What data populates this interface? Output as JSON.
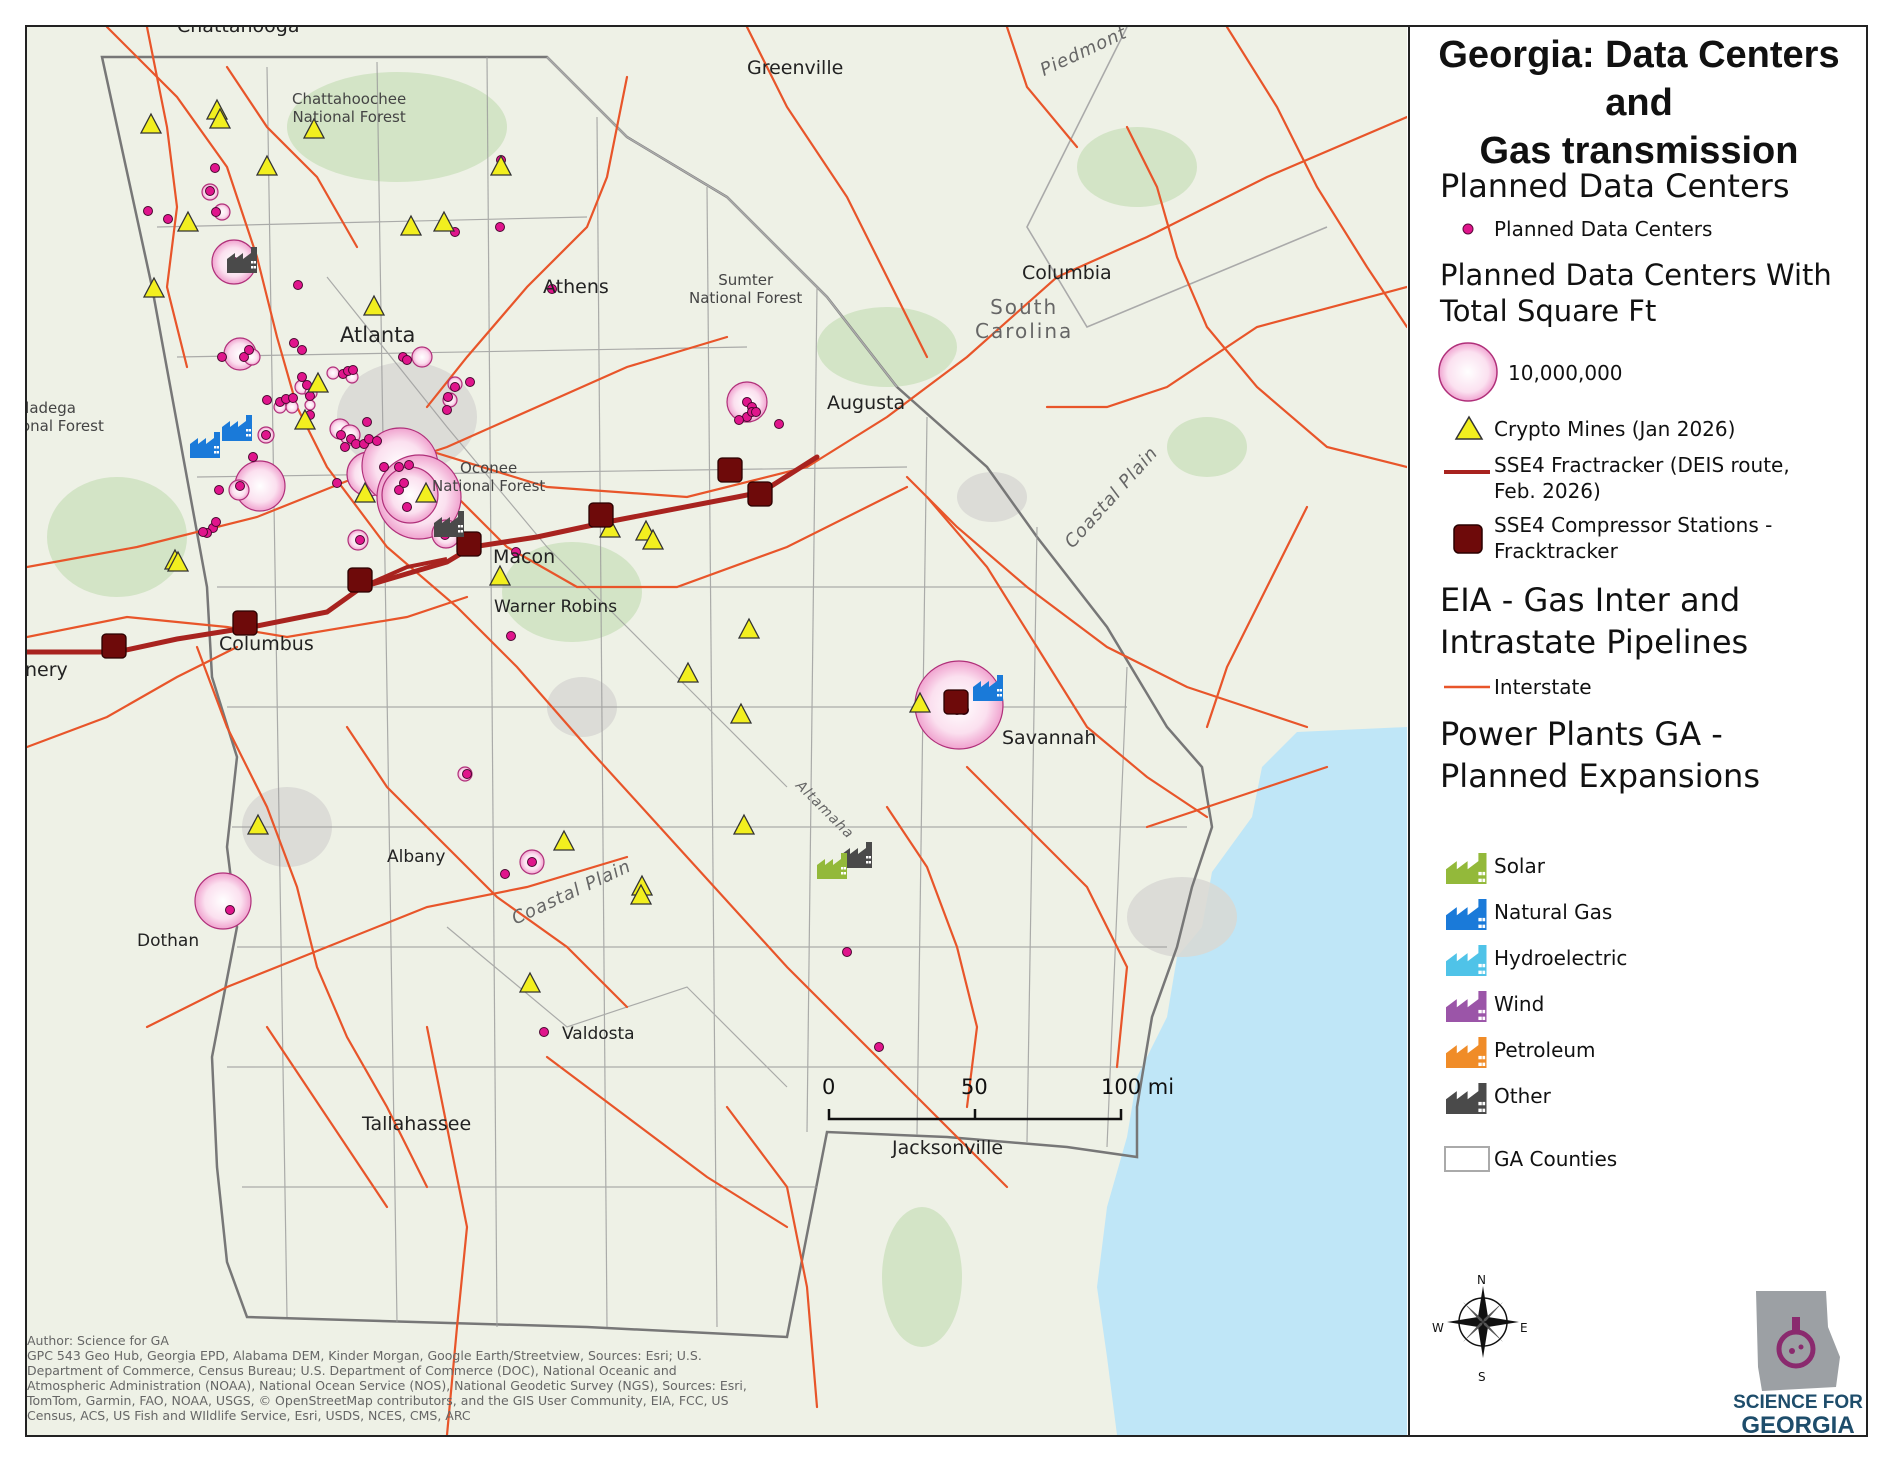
{
  "title_line1": "Georgia: Data Centers and",
  "title_line2": "Gas transmission",
  "legend": {
    "planned_header": "Planned Data Centers",
    "planned_item": "Planned Data Centers",
    "sqft_header_1": "Planned Data Centers With",
    "sqft_header_2": "Total Square Ft",
    "sqft_value": "10,000,000",
    "crypto": "Crypto Mines (Jan 2026)",
    "sse4_route_1": "SSE4 Fractracker (DEIS route,",
    "sse4_route_2": "Feb. 2026)",
    "sse4_comp_1": "SSE4 Compressor Stations -",
    "sse4_comp_2": "Fracktracker",
    "eia_header_1": "EIA - Gas Inter and",
    "eia_header_2": "Intrastate Pipelines",
    "interstate": "Interstate",
    "power_header_1": "Power Plants GA -",
    "power_header_2": "Planned Expansions",
    "solar": "Solar",
    "natural_gas": "Natural Gas",
    "hydro": "Hydroelectric",
    "wind": "Wind",
    "petroleum": "Petroleum",
    "other": "Other",
    "counties": "GA Counties"
  },
  "colors": {
    "pipeline": "#e8552a",
    "sse4": "#a8231f",
    "compressor": "#6e0a0a",
    "datacenter": "#e0158c",
    "datacenter_halo": "#f7c5e2",
    "crypto": "#f2ef1f",
    "solar": "#93b93a",
    "natural_gas": "#1a7ad9",
    "hydro": "#4fc3e8",
    "wind": "#9b55a8",
    "petroleum": "#f08c28",
    "other": "#4a4a4a",
    "water": "#bfe6f7"
  },
  "map_labels": {
    "chattanooga": "Chattanooga",
    "greenville": "Greenville",
    "chatt_forest_1": "Chattahoochee",
    "chatt_forest_2": "National Forest",
    "piedmont": "Piedmont",
    "athens": "Athens",
    "sumter_1": "Sumter",
    "sumter_2": "National Forest",
    "columbia": "Columbia",
    "sc_1": "South",
    "sc_2": "Carolina",
    "atlanta": "Atlanta",
    "talladega_1": "lladega",
    "talladega_2": "onal Forest",
    "augusta": "Augusta",
    "oconee_1": "Oconee",
    "oconee_2": "National Forest",
    "coastal_plain": "Coastal Plain",
    "macon": "Macon",
    "warner_robins": "Warner Robins",
    "columbus": "Columbus",
    "montgomery": "nery",
    "savannah": "Savannah",
    "altamaha": "Altamaha",
    "albany": "Albany",
    "coastal_plain_2": "Coastal Plain",
    "dothan": "Dothan",
    "valdosta": "Valdosta",
    "tallahassee": "Tallahassee",
    "jacksonville": "Jacksonville"
  },
  "scale": {
    "s0": "0",
    "s50": "50",
    "s100": "100 mi"
  },
  "compass": {
    "n": "N",
    "s": "S",
    "e": "E",
    "w": "W"
  },
  "logo": {
    "line1": "SCIENCE FOR",
    "line2": "GEORGIA"
  },
  "attribution": [
    "Author: Science for GA",
    "GPC 543 Geo Hub, Georgia EPD, Alabama DEM, Kinder Morgan, Google Earth/Streetview, Sources: Esri; U.S.",
    "Department of Commerce, Census Bureau; U.S. Department of Commerce (DOC), National Oceanic and",
    "Atmospheric Administration (NOAA), National Ocean Service (NOS), National Geodetic Survey (NGS), Sources: Esri,",
    "TomTom, Garmin, FAO, NOAA, USGS, © OpenStreetMap contributors, and the GIS User Community, EIA, FCC, US",
    "Census, ACS, US Fish and WIldlife Service, Esri, USDS, NCES, CMS, ARC"
  ]
}
